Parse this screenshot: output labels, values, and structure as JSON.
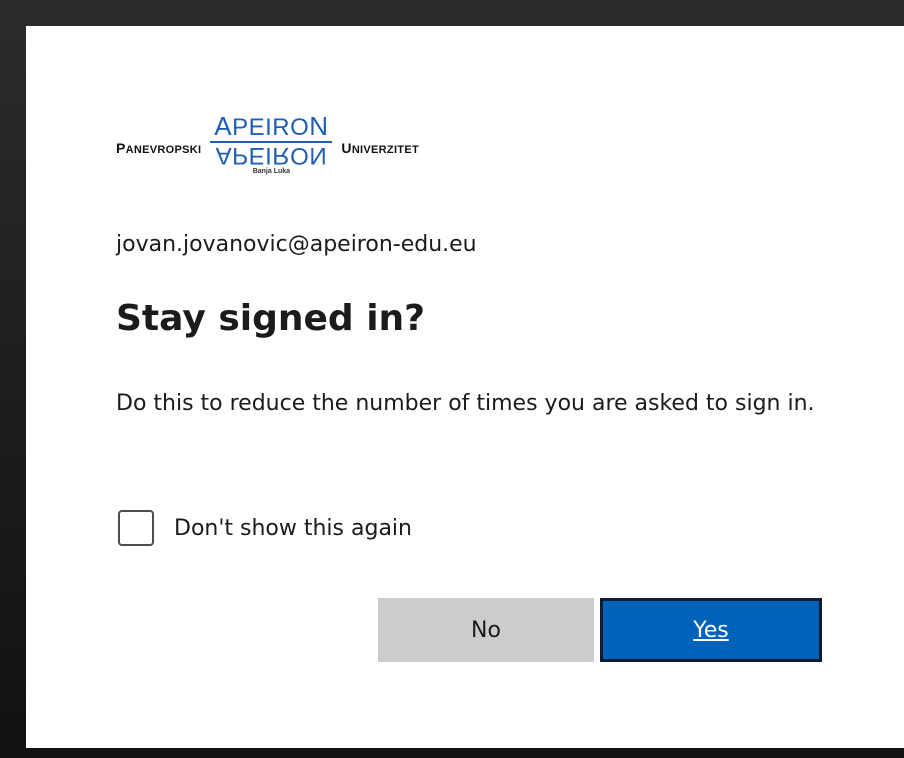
{
  "logo": {
    "left_text": "Panevropski",
    "center_top": "ApeiroN",
    "center_mirror": "ApeiroN",
    "center_sub": "Banja Luka",
    "right_text": "Univerzitet",
    "colors": {
      "brand_blue": "#1f5fb0"
    }
  },
  "account": {
    "email": "jovan.jovanovic@apeiron-edu.eu"
  },
  "dialog": {
    "title": "Stay signed in?",
    "description": "Do this to reduce the number of times you are asked to sign in.",
    "checkbox_label": "Don't show this again",
    "checkbox_checked": false
  },
  "buttons": {
    "no_label": "No",
    "yes_label": "Yes"
  },
  "colors": {
    "primary": "#0062b8",
    "secondary_button": "#cccccc",
    "text": "#1b1b1b"
  }
}
